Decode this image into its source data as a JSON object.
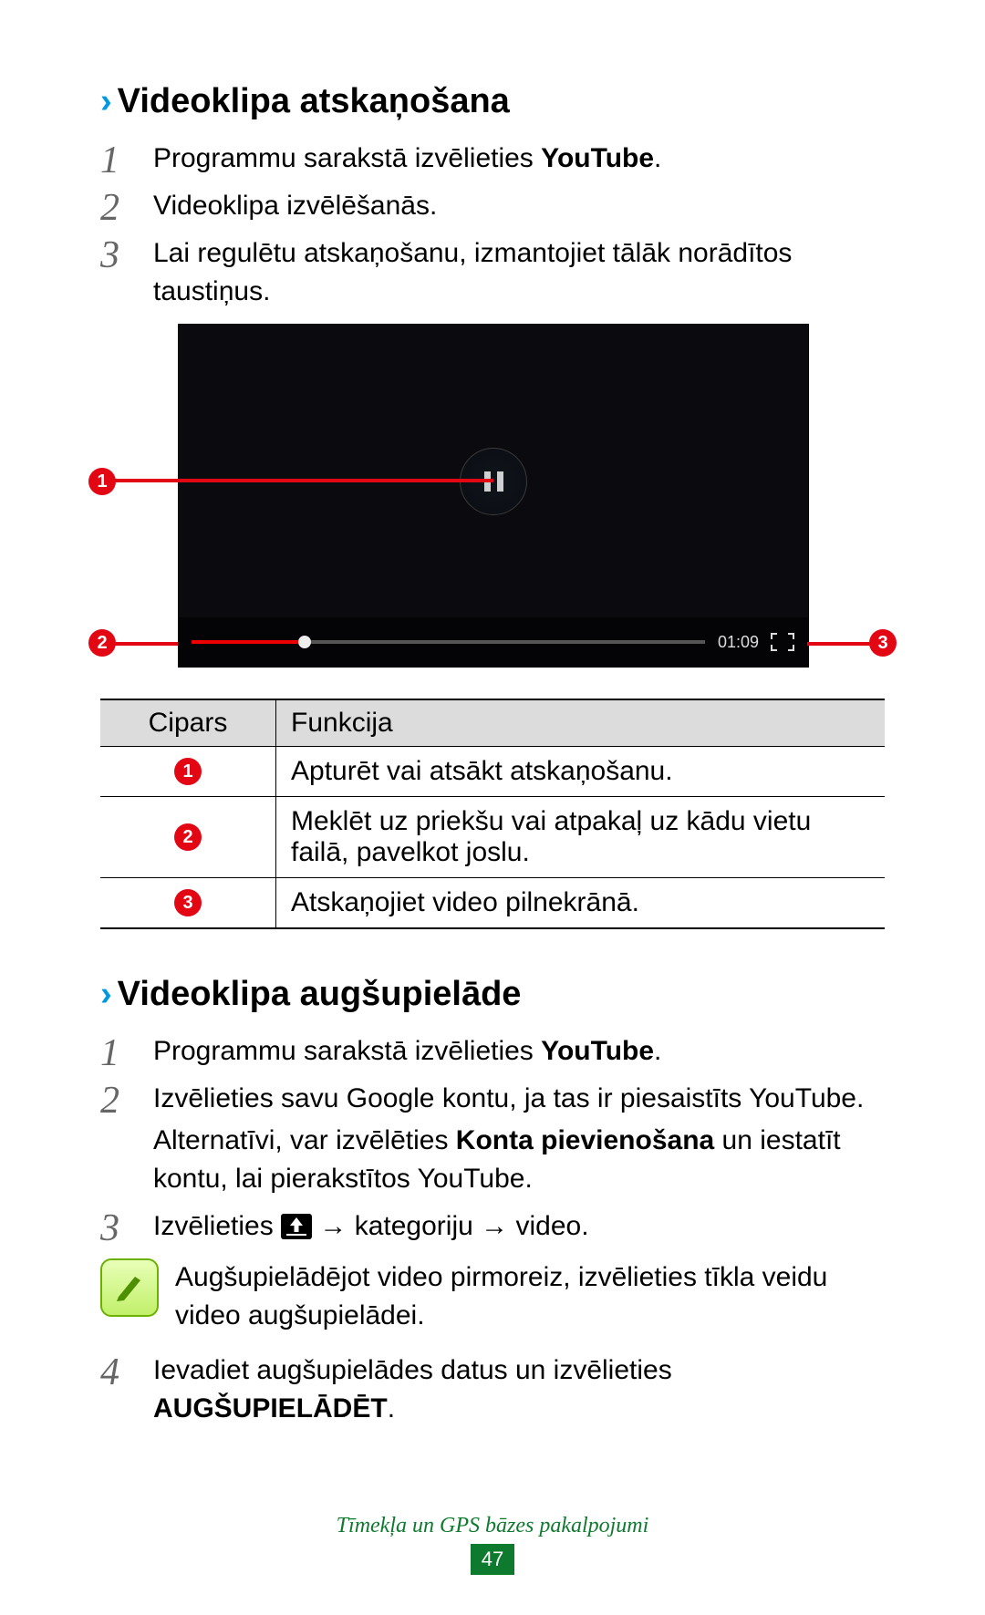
{
  "section1": {
    "title": "Videoklipa atskaņošana",
    "steps": [
      {
        "pre": "Programmu sarakstā izvēlieties ",
        "bold": "YouTube",
        "post": "."
      },
      {
        "plain": "Videoklipa izvēlēšanās."
      },
      {
        "plain": "Lai regulētu atskaņošanu, izmantojiet tālāk norādītos taustiņus."
      }
    ]
  },
  "video": {
    "time": "01:09"
  },
  "table": {
    "head_cipars": "Cipars",
    "head_funkcija": "Funkcija",
    "rows": [
      "Apturēt vai atsākt atskaņošanu.",
      "Meklēt uz priekšu vai atpakaļ uz kādu vietu failā, pavelkot joslu.",
      "Atskaņojiet video pilnekrānā."
    ]
  },
  "section2": {
    "title": "Videoklipa augšupielāde",
    "steps": [
      {
        "pre": "Programmu sarakstā izvēlieties ",
        "bold": "YouTube",
        "post": "."
      },
      {
        "plain": "Izvēlieties savu Google kontu, ja tas ir piesaistīts YouTube."
      },
      {
        "plain_is_step3_custom": true
      },
      {
        "pre": "Ievadiet augšupielādes datus un izvēlieties ",
        "bold": "AUGŠUPIELĀDĒT",
        "post": "."
      }
    ],
    "step2_cont_pre": "Alternatīvi, var izvēlēties ",
    "step2_cont_bold": "Konta pievienošana",
    "step2_cont_post": " un iestatīt kontu, lai pierakstītos YouTube.",
    "step3_pre": "Izvēlieties ",
    "step3_post": " → kategoriju → video.",
    "note": "Augšupielādējot video pirmoreiz, izvēlieties tīkla veidu video augšupielādei."
  },
  "footer": {
    "text": "Tīmekļa un GPS bāzes pakalpojumi",
    "page": "47"
  }
}
